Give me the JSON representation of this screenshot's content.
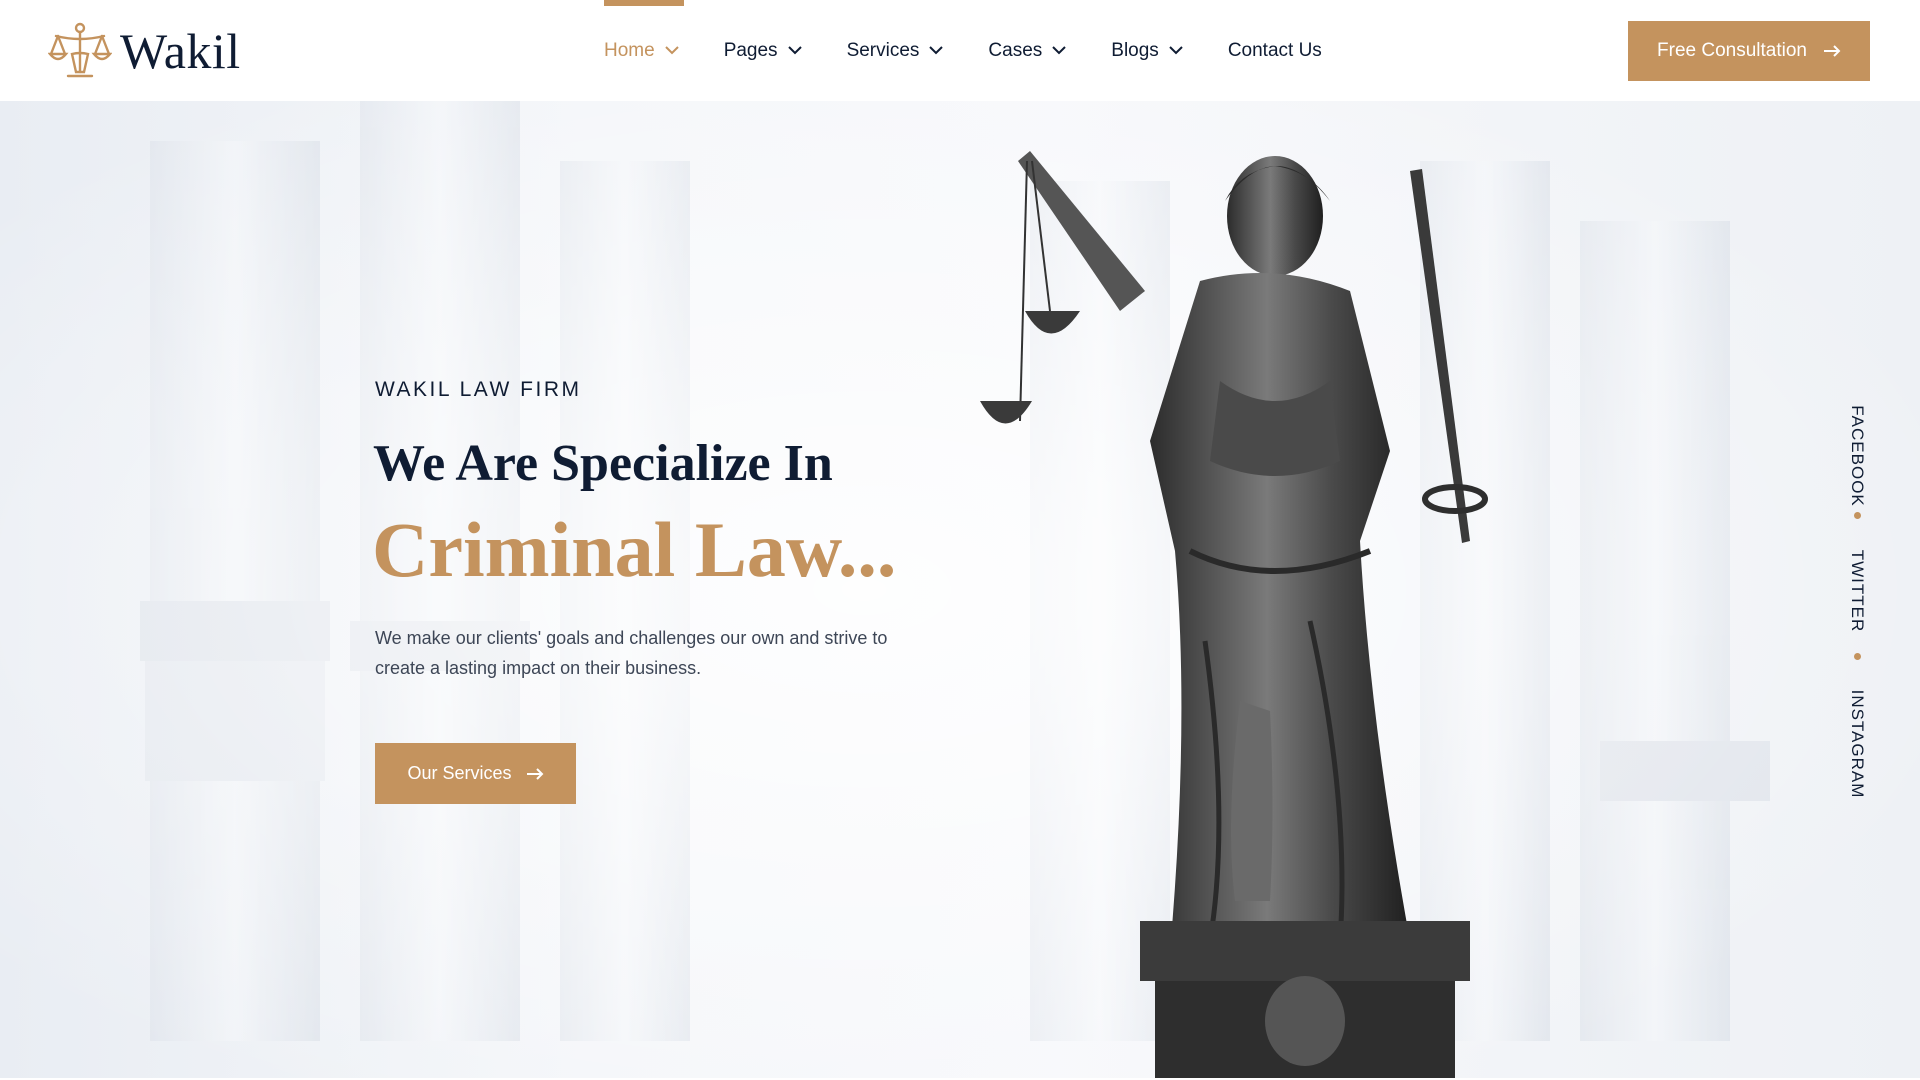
{
  "brand": {
    "name": "Wakil",
    "accent_color": "#c4935e",
    "dark_color": "#0f1c33",
    "logo_icon": "scales-of-justice-icon"
  },
  "nav": {
    "items": [
      {
        "label": "Home",
        "has_dropdown": true,
        "active": true
      },
      {
        "label": "Pages",
        "has_dropdown": true,
        "active": false
      },
      {
        "label": "Services",
        "has_dropdown": true,
        "active": false
      },
      {
        "label": "Cases",
        "has_dropdown": true,
        "active": false
      },
      {
        "label": "Blogs",
        "has_dropdown": true,
        "active": false
      },
      {
        "label": "Contact Us",
        "has_dropdown": false,
        "active": false
      }
    ],
    "cta_label": "Free Consultation"
  },
  "hero": {
    "eyebrow": "WAKIL LAW FIRM",
    "headline": "We Are Specialize In",
    "headline_accent": "Criminal Law...",
    "description": "We make our clients' goals and challenges our own and strive to create a lasting impact on their business.",
    "button_label": "Our Services",
    "image": "lady-justice-statue"
  },
  "social": {
    "links": [
      "FACEBOOK",
      "TWITTER",
      "INSTAGRAM"
    ]
  }
}
